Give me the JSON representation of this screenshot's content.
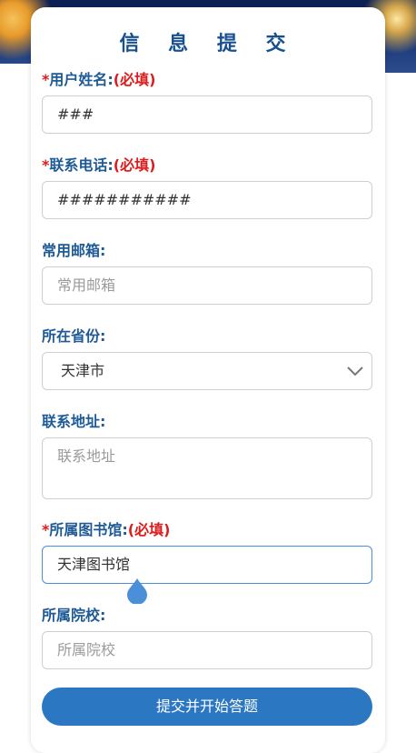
{
  "form": {
    "title": "信 息 提 交",
    "username": {
      "label": "用户姓名:",
      "required_text": "(必填)",
      "value": "###"
    },
    "phone": {
      "label": "联系电话:",
      "required_text": "(必填)",
      "value": "###########"
    },
    "email": {
      "label": "常用邮箱:",
      "placeholder": "常用邮箱"
    },
    "province": {
      "label": "所在省份:",
      "selected": "天津市"
    },
    "address": {
      "label": "联系地址:",
      "placeholder": "联系地址"
    },
    "library": {
      "label": "所属图书馆:",
      "required_text": "(必填)",
      "value": "天津图书馆"
    },
    "school": {
      "label": "所属院校:",
      "placeholder": "所属院校"
    },
    "submit_label": "提交并开始答题"
  },
  "icons": {
    "select": "chevron-down-icon",
    "cursor": "text-cursor-drop-icon"
  },
  "colors": {
    "accent": "#2b77c2",
    "label": "#1e5a96",
    "required": "#e01b1b"
  }
}
